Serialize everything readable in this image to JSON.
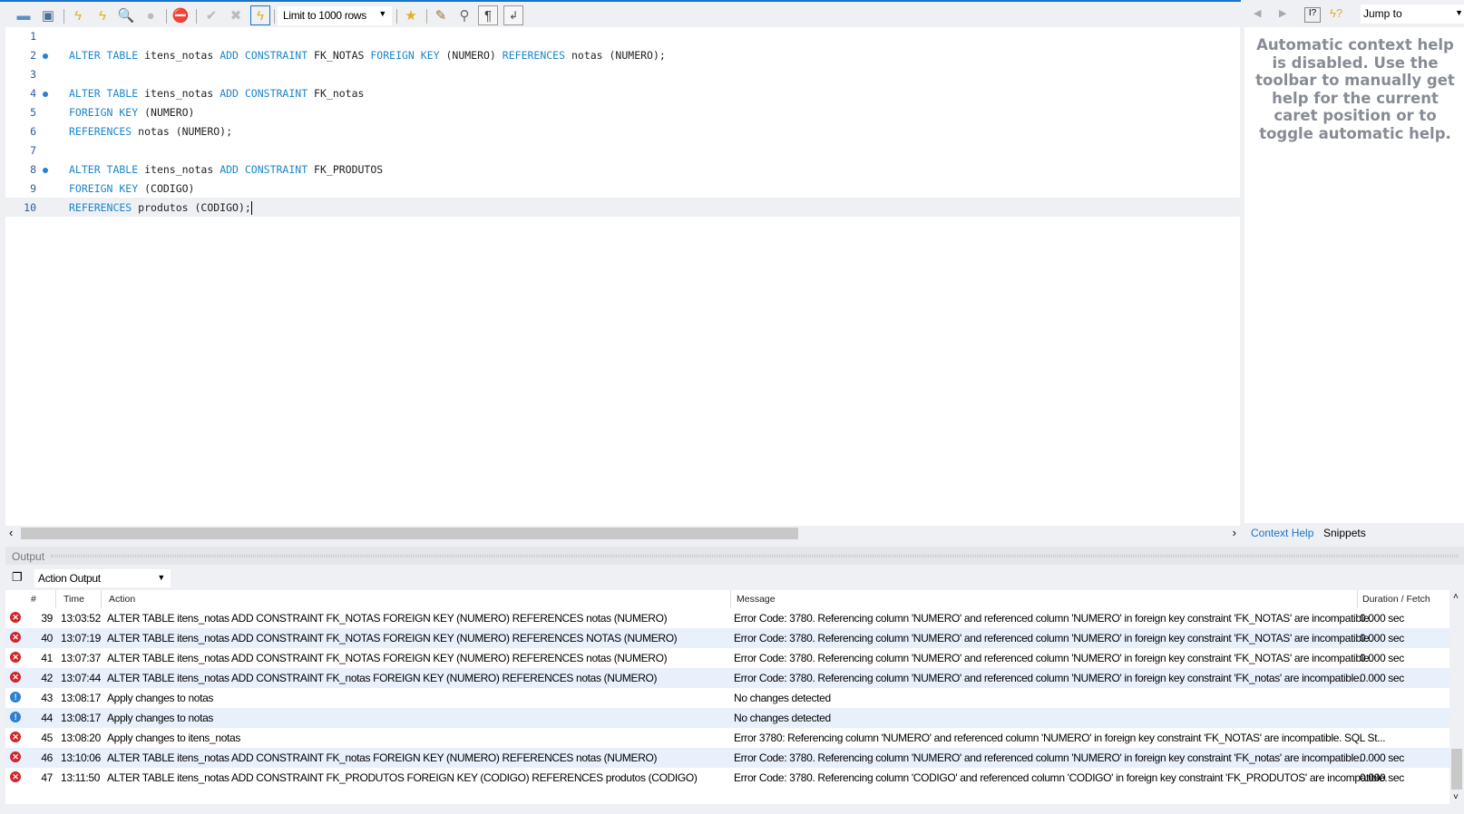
{
  "toolbar": {
    "limit_label": "Limit to 1000 rows",
    "icons": [
      "open-folder-icon",
      "save-icon",
      "execute-icon",
      "execute-current-icon",
      "explain-icon",
      "stop-icon",
      "toggle-error-icon",
      "commit-icon",
      "rollback-icon",
      "autocommit-icon",
      "add-snippet-icon",
      "beautify-icon",
      "find-icon",
      "invisible-chars-icon",
      "word-wrap-icon"
    ]
  },
  "editor": {
    "lines": [
      {
        "n": "1",
        "dot": false,
        "parts": []
      },
      {
        "n": "2",
        "dot": true,
        "parts": [
          [
            "kw",
            "ALTER TABLE"
          ],
          [
            "t",
            " itens_notas "
          ],
          [
            "kw",
            "ADD CONSTRAINT"
          ],
          [
            "t",
            " FK_NOTAS "
          ],
          [
            "kw",
            "FOREIGN KEY"
          ],
          [
            "t",
            " (NUMERO) "
          ],
          [
            "kw",
            "REFERENCES"
          ],
          [
            "t",
            " notas (NUMERO);"
          ]
        ]
      },
      {
        "n": "3",
        "dot": false,
        "parts": []
      },
      {
        "n": "4",
        "dot": true,
        "parts": [
          [
            "kw",
            "ALTER TABLE"
          ],
          [
            "t",
            " itens_notas "
          ],
          [
            "kw",
            "ADD CONSTRAINT"
          ],
          [
            "t",
            " FK_notas"
          ]
        ]
      },
      {
        "n": "5",
        "dot": false,
        "parts": [
          [
            "kw",
            "FOREIGN KEY"
          ],
          [
            "t",
            " (NUMERO)"
          ]
        ]
      },
      {
        "n": "6",
        "dot": false,
        "parts": [
          [
            "kw",
            "REFERENCES"
          ],
          [
            "t",
            " notas (NUMERO);"
          ]
        ]
      },
      {
        "n": "7",
        "dot": false,
        "parts": []
      },
      {
        "n": "8",
        "dot": true,
        "parts": [
          [
            "kw",
            "ALTER TABLE"
          ],
          [
            "t",
            " itens_notas "
          ],
          [
            "kw",
            "ADD CONSTRAINT"
          ],
          [
            "t",
            " FK_PRODUTOS"
          ]
        ]
      },
      {
        "n": "9",
        "dot": false,
        "parts": [
          [
            "kw",
            "FOREIGN KEY"
          ],
          [
            "t",
            " (CODIGO)"
          ]
        ]
      },
      {
        "n": "10",
        "dot": false,
        "parts": [
          [
            "kw",
            "REFERENCES"
          ],
          [
            "t",
            " produtos (CODIGO);"
          ]
        ]
      }
    ]
  },
  "right_panel": {
    "jump_label": "Jump to",
    "help_text": "Automatic context help is disabled. Use the toolbar to manually get help for the current caret position or to toggle automatic help.",
    "tabs": [
      "Context Help",
      "Snippets"
    ],
    "active_tab": "Context Help"
  },
  "output": {
    "title": "Output",
    "selector": "Action Output",
    "columns": [
      "#",
      "Time",
      "Action",
      "Message",
      "Duration / Fetch"
    ],
    "rows": [
      {
        "status": "error",
        "n": "39",
        "time": "13:03:52",
        "action": "ALTER TABLE itens_notas ADD CONSTRAINT FK_NOTAS FOREIGN KEY (NUMERO) REFERENCES notas (NUMERO)",
        "message": "Error Code: 3780. Referencing column 'NUMERO' and referenced column 'NUMERO' in foreign key constraint 'FK_NOTAS' are incompatible.",
        "duration": "0.000 sec"
      },
      {
        "status": "error",
        "n": "40",
        "time": "13:07:19",
        "action": "ALTER TABLE itens_notas ADD CONSTRAINT FK_NOTAS FOREIGN KEY (NUMERO) REFERENCES NOTAS (NUMERO)",
        "message": "Error Code: 3780. Referencing column 'NUMERO' and referenced column 'NUMERO' in foreign key constraint 'FK_NOTAS' are incompatible.",
        "duration": "0.000 sec"
      },
      {
        "status": "error",
        "n": "41",
        "time": "13:07:37",
        "action": "ALTER TABLE itens_notas ADD CONSTRAINT FK_NOTAS FOREIGN KEY (NUMERO) REFERENCES notas (NUMERO)",
        "message": "Error Code: 3780. Referencing column 'NUMERO' and referenced column 'NUMERO' in foreign key constraint 'FK_NOTAS' are incompatible.",
        "duration": "0.000 sec"
      },
      {
        "status": "error",
        "n": "42",
        "time": "13:07:44",
        "action": "ALTER TABLE itens_notas ADD CONSTRAINT FK_notas FOREIGN KEY (NUMERO) REFERENCES notas (NUMERO)",
        "message": "Error Code: 3780. Referencing column 'NUMERO' and referenced column 'NUMERO' in foreign key constraint 'FK_notas' are incompatible.",
        "duration": "0.000 sec"
      },
      {
        "status": "info",
        "n": "43",
        "time": "13:08:17",
        "action": "Apply changes to notas",
        "message": "No changes detected",
        "duration": ""
      },
      {
        "status": "info",
        "n": "44",
        "time": "13:08:17",
        "action": "Apply changes to notas",
        "message": "No changes detected",
        "duration": ""
      },
      {
        "status": "error",
        "n": "45",
        "time": "13:08:20",
        "action": "Apply changes to itens_notas",
        "message": "Error 3780: Referencing column 'NUMERO' and referenced column 'NUMERO' in foreign key constraint 'FK_NOTAS' are incompatible. SQL St...",
        "duration": ""
      },
      {
        "status": "error",
        "n": "46",
        "time": "13:10:06",
        "action": "ALTER TABLE itens_notas ADD CONSTRAINT FK_notas FOREIGN KEY (NUMERO) REFERENCES notas (NUMERO)",
        "message": "Error Code: 3780. Referencing column 'NUMERO' and referenced column 'NUMERO' in foreign key constraint 'FK_notas' are incompatible.",
        "duration": "0.000 sec"
      },
      {
        "status": "error",
        "n": "47",
        "time": "13:11:50",
        "action": "ALTER TABLE itens_notas ADD CONSTRAINT FK_PRODUTOS FOREIGN KEY (CODIGO) REFERENCES produtos (CODIGO)",
        "message": "Error Code: 3780. Referencing column 'CODIGO' and referenced column 'CODIGO' in foreign key constraint 'FK_PRODUTOS' are incompatible.",
        "duration": "0.000 sec"
      }
    ]
  },
  "colors": {
    "accent": "#1a73c8",
    "keyword": "#1d86c8",
    "error": "#d0262b",
    "info": "#2f7fd0",
    "row_alt": "#e8f0fc"
  }
}
